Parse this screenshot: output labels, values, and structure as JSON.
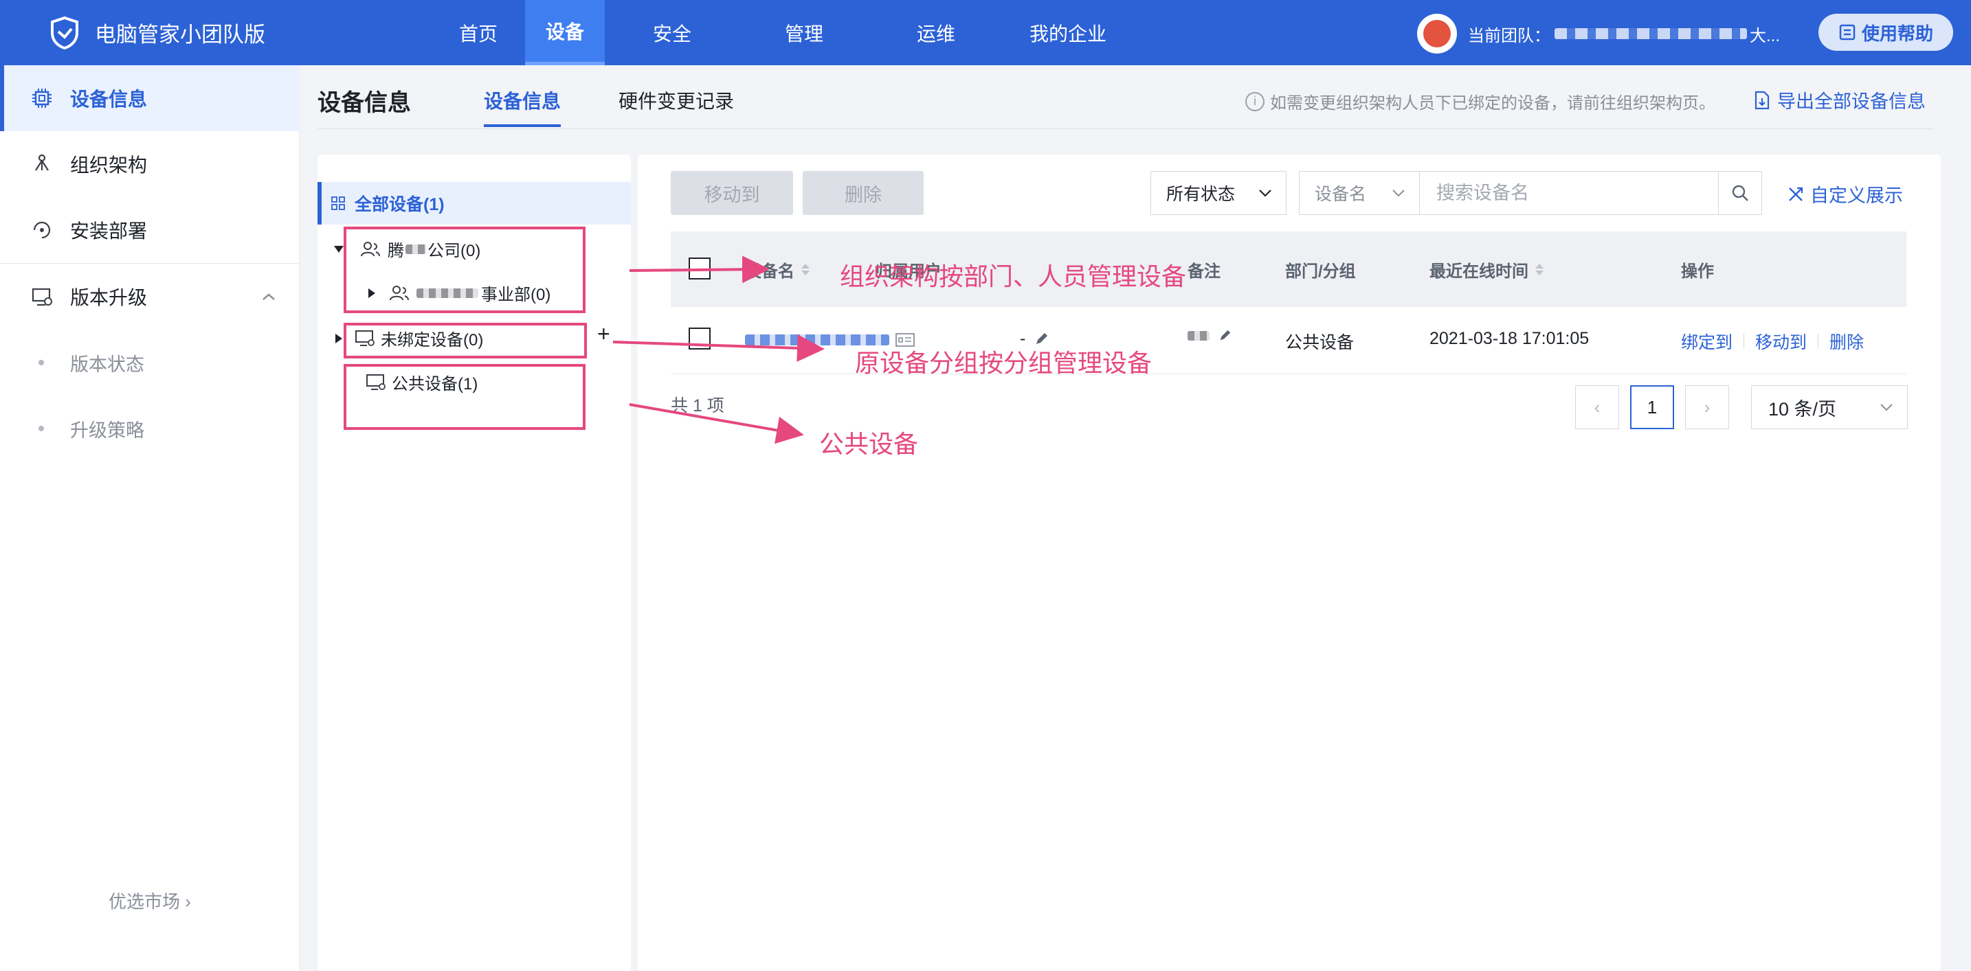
{
  "brand": {
    "name": "电脑管家小团队版"
  },
  "nav": [
    {
      "label": "首页"
    },
    {
      "label": "设备"
    },
    {
      "label": "安全"
    },
    {
      "label": "管理"
    },
    {
      "label": "运维"
    },
    {
      "label": "我的企业"
    }
  ],
  "team": {
    "label": "当前团队：",
    "suffix": "大..."
  },
  "help": {
    "label": "使用帮助"
  },
  "sidebar": {
    "items": [
      {
        "label": "设备信息",
        "icon": "chip-icon"
      },
      {
        "label": "组织架构",
        "icon": "org-tree-icon"
      },
      {
        "label": "安装部署",
        "icon": "deploy-icon"
      },
      {
        "label": "版本升级",
        "icon": "upgrade-icon"
      }
    ],
    "subitems": [
      {
        "label": "版本状态"
      },
      {
        "label": "升级策略"
      }
    ],
    "market": "优选市场 ›"
  },
  "header": {
    "title": "设备信息",
    "tabs": [
      {
        "label": "设备信息"
      },
      {
        "label": "硬件变更记录"
      }
    ],
    "tip": "如需变更组织架构人员下已绑定的设备，请前往组织架构页。",
    "export": "导出全部设备信息"
  },
  "tree": {
    "all": "全部设备(1)",
    "company": {
      "prefix": "腾",
      "suffix": "公司(0)"
    },
    "dept": {
      "suffix": "事业部(0)"
    },
    "unbound": "未绑定设备(0)",
    "public": "公共设备(1)",
    "add": "+"
  },
  "toolbar": {
    "move": "移动到",
    "delete": "删除",
    "status": "所有状态",
    "field": "设备名",
    "search_placeholder": "搜索设备名",
    "customize": "自定义展示"
  },
  "table": {
    "columns": [
      "设备名",
      "归属用户",
      "备注",
      "部门/分组",
      "最近在线时间",
      "操作"
    ],
    "rows": [
      {
        "user": "-",
        "group": "公共设备",
        "last_online": "2021-03-18 17:01:05",
        "ops": [
          "绑定到",
          "移动到",
          "删除"
        ]
      }
    ]
  },
  "pagination": {
    "total": "共 1 项",
    "prev": "‹",
    "current": "1",
    "next": "›",
    "page_size": "10 条/页"
  },
  "annotations": [
    {
      "text": "组织架构按部门、人员管理设备"
    },
    {
      "text": "原设备分组按分组管理设备"
    },
    {
      "text": "公共设备"
    }
  ],
  "colors": {
    "primary": "#2c62d6",
    "annotation": "#e5487f"
  }
}
